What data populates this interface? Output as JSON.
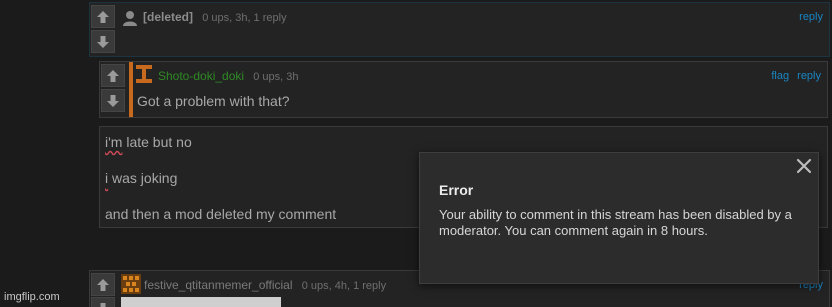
{
  "comments": [
    {
      "author": "[deleted]",
      "meta": "0 ups, 3h, 1 reply",
      "actions": [
        "reply"
      ]
    },
    {
      "author": "Shoto-doki_doki",
      "meta": "0 ups, 3h",
      "actions": [
        "flag",
        "reply"
      ],
      "body": "Got a problem with that?"
    },
    {
      "body_lines": [
        "i'm late but no",
        "i was joking",
        "and then a mod deleted my comment"
      ],
      "squiggle_words": [
        "i'm",
        "i"
      ]
    },
    {
      "author": "festive_qtitanmemer_official",
      "meta": "0 ups, 4h, 1 reply",
      "actions": [
        "reply"
      ]
    }
  ],
  "modal": {
    "title": "Error",
    "message": "Your ability to comment in this stream has been disabled by a moderator. You can comment again in 8 hours."
  },
  "watermark": "imgflip.com",
  "icons": {
    "vote_up": "up-arrow-icon",
    "vote_down": "down-arrow-icon",
    "close": "close-icon"
  },
  "colors": {
    "link": "#1a85c4",
    "author_green": "#2e8a24",
    "accent_orange": "#c76a1e"
  }
}
